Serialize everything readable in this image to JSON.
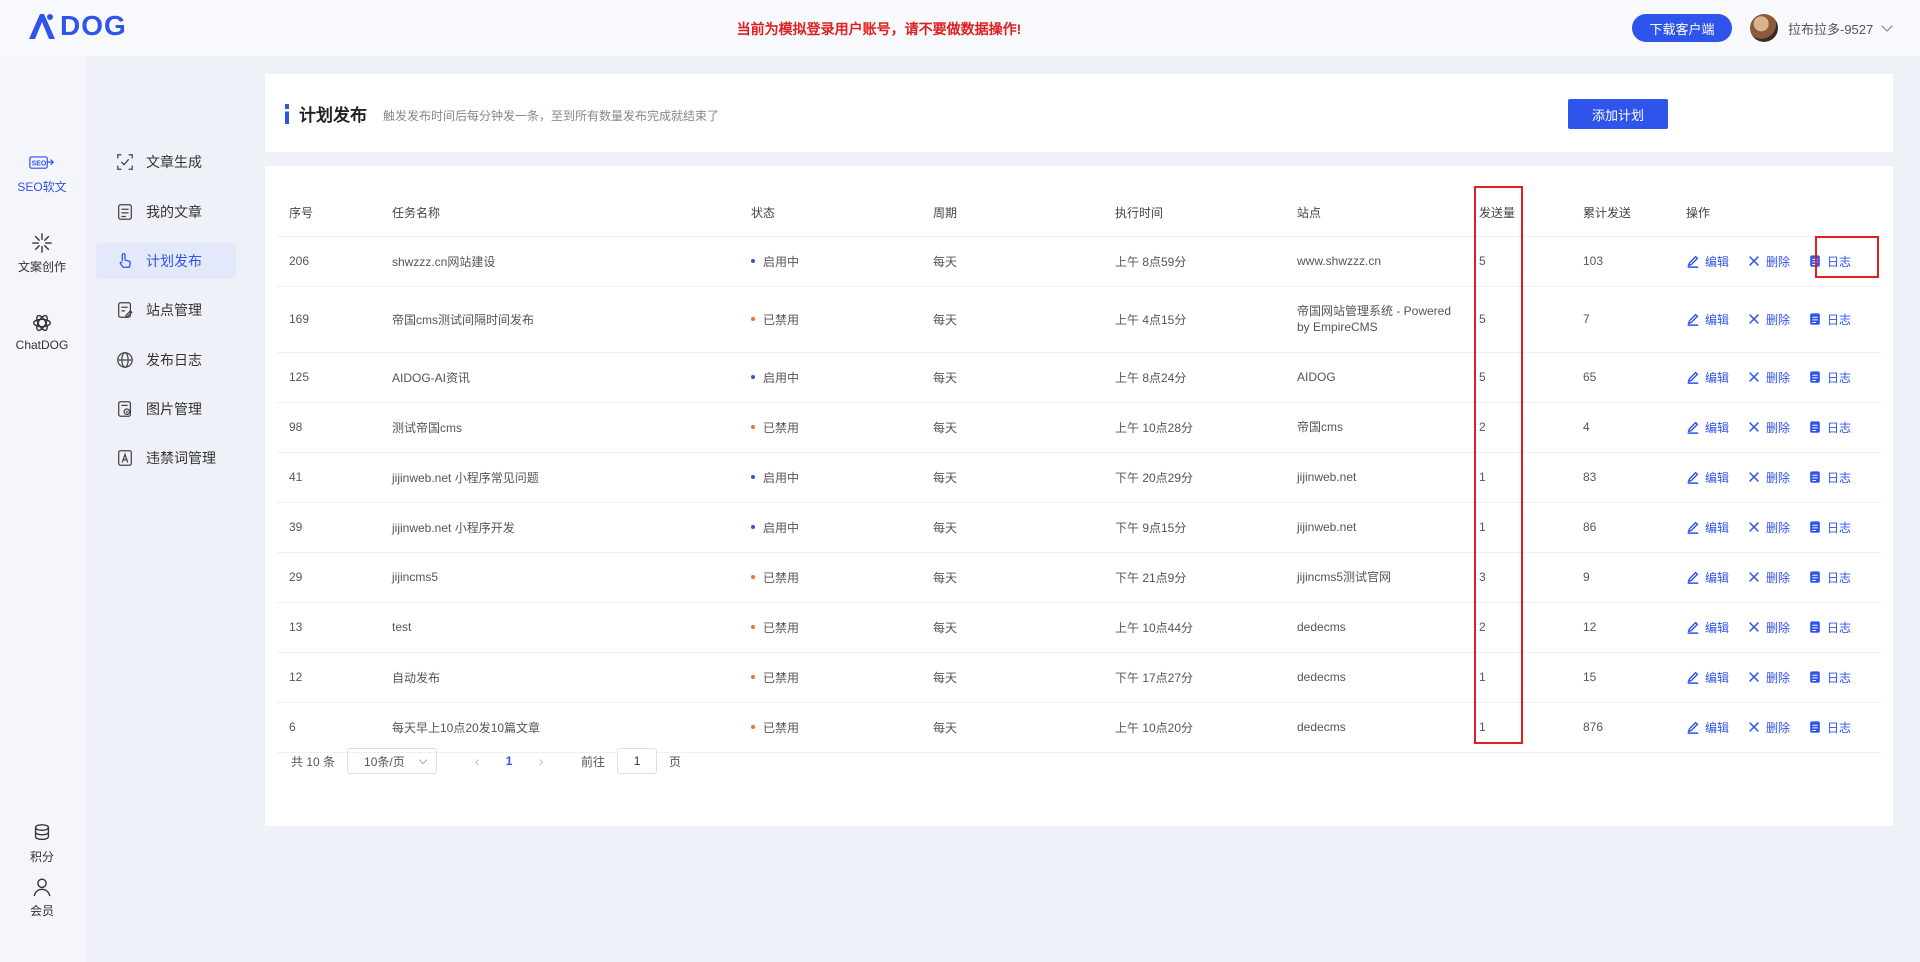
{
  "header": {
    "logo": "AIDOG",
    "notice": "当前为模拟登录用户账号，请不要做数据操作!",
    "download_label": "下载客户端",
    "username": "拉布拉多-9527"
  },
  "rail": {
    "seo": "SEO软文",
    "copy": "文案创作",
    "chat": "ChatDOG",
    "points": "积分",
    "member": "会员"
  },
  "subnav": {
    "items": [
      {
        "label": "文章生成",
        "icon": "scan-icon"
      },
      {
        "label": "我的文章",
        "icon": "document-icon"
      },
      {
        "label": "计划发布",
        "icon": "hand-pointer-icon"
      },
      {
        "label": "站点管理",
        "icon": "edit-doc-icon"
      },
      {
        "label": "发布日志",
        "icon": "globe-icon"
      },
      {
        "label": "图片管理",
        "icon": "image-file-icon"
      },
      {
        "label": "违禁词管理",
        "icon": "forbidden-doc-icon"
      }
    ]
  },
  "page": {
    "title": "计划发布",
    "desc": "触发发布时间后每分钟发一条，至到所有数量发布完成就结束了",
    "add_label": "添加计划"
  },
  "table": {
    "headers": [
      "序号",
      "任务名称",
      "状态",
      "周期",
      "执行时间",
      "站点",
      "发送量",
      "累计发送",
      "操作"
    ],
    "ops": {
      "edit": "编辑",
      "delete": "删除",
      "log": "日志"
    },
    "rows": [
      {
        "id": "206",
        "name": "shwzzz.cn网站建设",
        "status": "启用中",
        "active": true,
        "cycle": "每天",
        "time": "上午 8点59分",
        "site": "www.shwzzz.cn",
        "count": "5",
        "total": "103"
      },
      {
        "id": "169",
        "name": "帝国cms测试间隔时间发布",
        "status": "已禁用",
        "active": false,
        "cycle": "每天",
        "time": "上午 4点15分",
        "site": "帝国网站管理系统 - Powered by EmpireCMS",
        "count": "5",
        "total": "7"
      },
      {
        "id": "125",
        "name": "AIDOG-AI资讯",
        "status": "启用中",
        "active": true,
        "cycle": "每天",
        "time": "上午 8点24分",
        "site": "AIDOG",
        "count": "5",
        "total": "65"
      },
      {
        "id": "98",
        "name": "测试帝国cms",
        "status": "已禁用",
        "active": false,
        "cycle": "每天",
        "time": "上午 10点28分",
        "site": "帝国cms",
        "count": "2",
        "total": "4"
      },
      {
        "id": "41",
        "name": "jijinweb.net 小程序常见问题",
        "status": "启用中",
        "active": true,
        "cycle": "每天",
        "time": "下午 20点29分",
        "site": "jijinweb.net",
        "count": "1",
        "total": "83"
      },
      {
        "id": "39",
        "name": "jijinweb.net 小程序开发",
        "status": "启用中",
        "active": true,
        "cycle": "每天",
        "time": "下午 9点15分",
        "site": "jijinweb.net",
        "count": "1",
        "total": "86"
      },
      {
        "id": "29",
        "name": "jijincms5",
        "status": "已禁用",
        "active": false,
        "cycle": "每天",
        "time": "下午 21点9分",
        "site": "jijincms5测试官网",
        "count": "3",
        "total": "9"
      },
      {
        "id": "13",
        "name": "test",
        "status": "已禁用",
        "active": false,
        "cycle": "每天",
        "time": "上午 10点44分",
        "site": "dedecms",
        "count": "2",
        "total": "12"
      },
      {
        "id": "12",
        "name": "自动发布",
        "status": "已禁用",
        "active": false,
        "cycle": "每天",
        "time": "下午 17点27分",
        "site": "dedecms",
        "count": "1",
        "total": "15"
      },
      {
        "id": "6",
        "name": "每天早上10点20发10篇文章",
        "status": "已禁用",
        "active": false,
        "cycle": "每天",
        "time": "上午 10点20分",
        "site": "dedecms",
        "count": "1",
        "total": "876"
      }
    ]
  },
  "pager": {
    "total": "共 10 条",
    "pagesize": "10条/页",
    "current": "1",
    "goto_prefix": "前往",
    "goto_value": "1",
    "goto_suffix": "页"
  },
  "colors": {
    "accent": "#2f54eb",
    "notice": "#e02020",
    "disabled_dot": "#f56c2d",
    "highlight": "#e02020"
  }
}
